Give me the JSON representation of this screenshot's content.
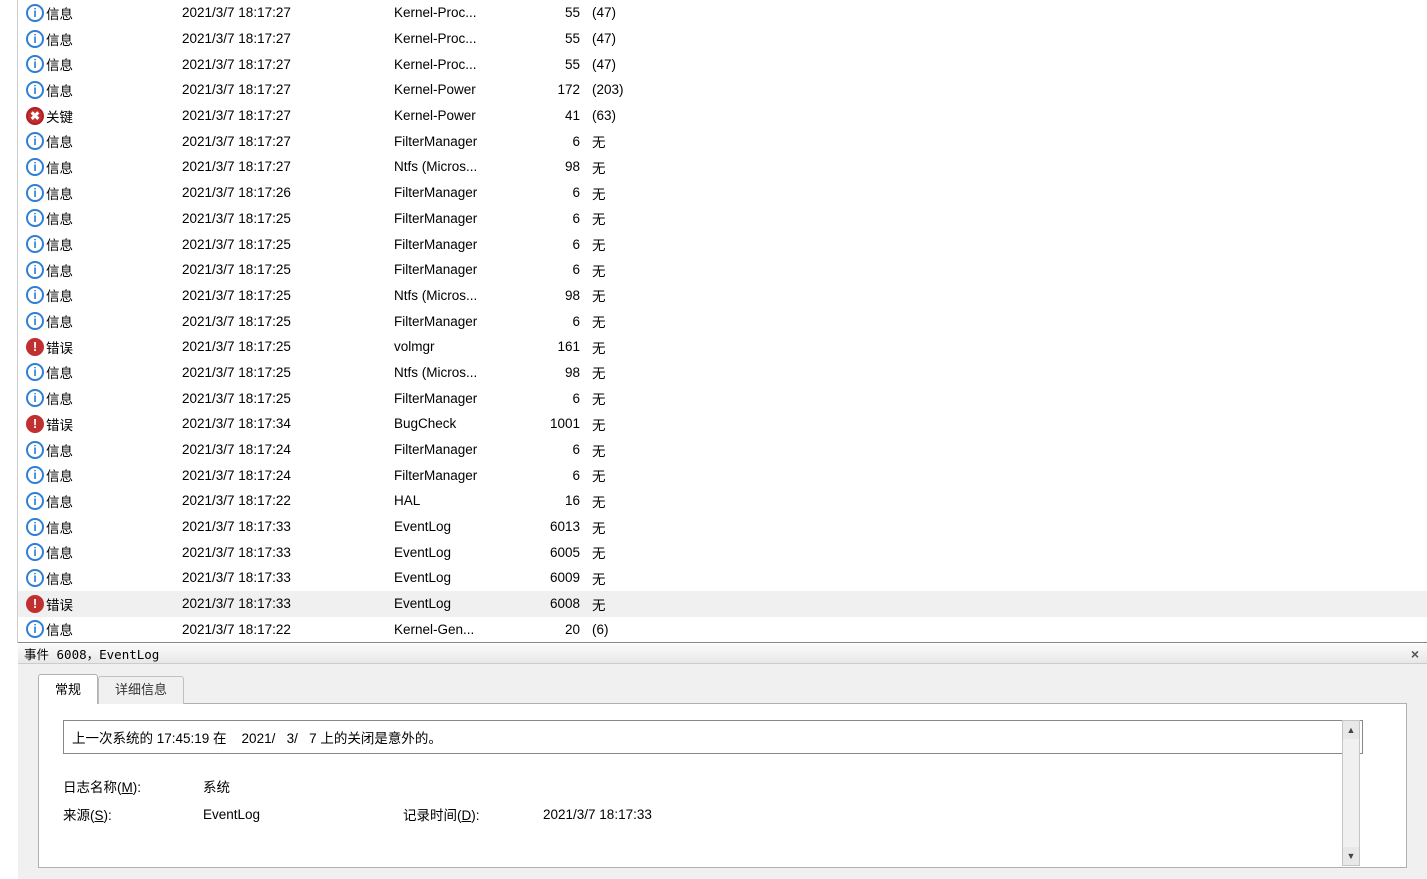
{
  "levels": {
    "info": "信息",
    "error": "错误",
    "critical": "关键"
  },
  "rows": [
    {
      "k": "info",
      "date": "2021/3/7 18:17:27",
      "src": "Kernel-Proc...",
      "id": 55,
      "task": "(47)"
    },
    {
      "k": "info",
      "date": "2021/3/7 18:17:27",
      "src": "Kernel-Proc...",
      "id": 55,
      "task": "(47)"
    },
    {
      "k": "info",
      "date": "2021/3/7 18:17:27",
      "src": "Kernel-Proc...",
      "id": 55,
      "task": "(47)"
    },
    {
      "k": "info",
      "date": "2021/3/7 18:17:27",
      "src": "Kernel-Power",
      "id": 172,
      "task": "(203)"
    },
    {
      "k": "critical",
      "date": "2021/3/7 18:17:27",
      "src": "Kernel-Power",
      "id": 41,
      "task": "(63)"
    },
    {
      "k": "info",
      "date": "2021/3/7 18:17:27",
      "src": "FilterManager",
      "id": 6,
      "task": "无"
    },
    {
      "k": "info",
      "date": "2021/3/7 18:17:27",
      "src": "Ntfs (Micros...",
      "id": 98,
      "task": "无"
    },
    {
      "k": "info",
      "date": "2021/3/7 18:17:26",
      "src": "FilterManager",
      "id": 6,
      "task": "无"
    },
    {
      "k": "info",
      "date": "2021/3/7 18:17:25",
      "src": "FilterManager",
      "id": 6,
      "task": "无"
    },
    {
      "k": "info",
      "date": "2021/3/7 18:17:25",
      "src": "FilterManager",
      "id": 6,
      "task": "无"
    },
    {
      "k": "info",
      "date": "2021/3/7 18:17:25",
      "src": "FilterManager",
      "id": 6,
      "task": "无"
    },
    {
      "k": "info",
      "date": "2021/3/7 18:17:25",
      "src": "Ntfs (Micros...",
      "id": 98,
      "task": "无"
    },
    {
      "k": "info",
      "date": "2021/3/7 18:17:25",
      "src": "FilterManager",
      "id": 6,
      "task": "无"
    },
    {
      "k": "error",
      "date": "2021/3/7 18:17:25",
      "src": "volmgr",
      "id": 161,
      "task": "无"
    },
    {
      "k": "info",
      "date": "2021/3/7 18:17:25",
      "src": "Ntfs (Micros...",
      "id": 98,
      "task": "无"
    },
    {
      "k": "info",
      "date": "2021/3/7 18:17:25",
      "src": "FilterManager",
      "id": 6,
      "task": "无"
    },
    {
      "k": "error",
      "date": "2021/3/7 18:17:34",
      "src": "BugCheck",
      "id": 1001,
      "task": "无"
    },
    {
      "k": "info",
      "date": "2021/3/7 18:17:24",
      "src": "FilterManager",
      "id": 6,
      "task": "无"
    },
    {
      "k": "info",
      "date": "2021/3/7 18:17:24",
      "src": "FilterManager",
      "id": 6,
      "task": "无"
    },
    {
      "k": "info",
      "date": "2021/3/7 18:17:22",
      "src": "HAL",
      "id": 16,
      "task": "无"
    },
    {
      "k": "info",
      "date": "2021/3/7 18:17:33",
      "src": "EventLog",
      "id": 6013,
      "task": "无"
    },
    {
      "k": "info",
      "date": "2021/3/7 18:17:33",
      "src": "EventLog",
      "id": 6005,
      "task": "无"
    },
    {
      "k": "info",
      "date": "2021/3/7 18:17:33",
      "src": "EventLog",
      "id": 6009,
      "task": "无"
    },
    {
      "k": "error",
      "date": "2021/3/7 18:17:33",
      "src": "EventLog",
      "id": 6008,
      "task": "无",
      "sel": true
    },
    {
      "k": "info",
      "date": "2021/3/7 18:17:22",
      "src": "Kernel-Gen...",
      "id": 20,
      "task": "(6)"
    }
  ],
  "pane": {
    "title": "事件 6008，EventLog",
    "close": "×",
    "tabs": {
      "general": "常规",
      "details": "详细信息"
    },
    "message": "上一次系统的 17:45:19 在    2021/   3/   7 上的关闭是意外的。",
    "props": {
      "logname_label_pre": "日志名称(",
      "logname_key": "M",
      "logname_label_post": "):",
      "logname_value": "系统",
      "source_label_pre": "来源(",
      "source_key": "S",
      "source_label_post": "):",
      "source_value": "EventLog",
      "logged_label_pre": "记录时间(",
      "logged_key": "D",
      "logged_label_post": "):",
      "logged_value": "2021/3/7 18:17:33"
    }
  }
}
